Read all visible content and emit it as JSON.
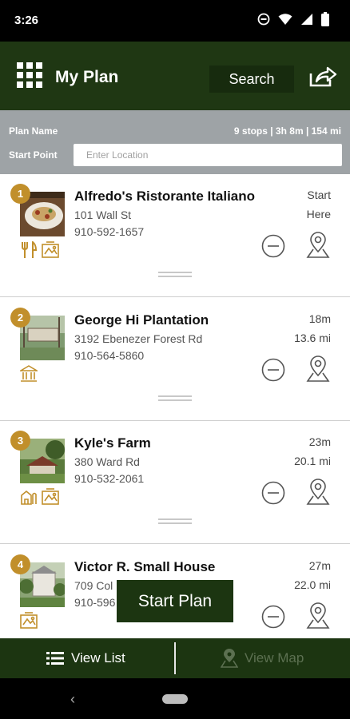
{
  "status_bar": {
    "time": "3:26",
    "icons": [
      "dnd-icon",
      "wifi-icon",
      "signal-icon",
      "battery-icon"
    ]
  },
  "app_bar": {
    "title": "My Plan",
    "search_label": "Search",
    "menu_icon": "grid-menu-icon",
    "share_icon": "share-icon"
  },
  "plan": {
    "name_label": "Plan Name",
    "stats": "9 stops | 3h 8m | 154 mi",
    "start_label": "Start Point",
    "start_placeholder": "Enter Location"
  },
  "stops": [
    {
      "number": "1",
      "name": "Alfredo's Ristorante Italiano",
      "address": "101 Wall St",
      "phone": "910-592-1657",
      "meta_top": "Start",
      "meta_bottom": "Here",
      "categories": [
        "dining-icon",
        "attraction-icon"
      ]
    },
    {
      "number": "2",
      "name": "George Hi Plantation",
      "address": "3192 Ebenezer Forest Rd",
      "phone": "910-564-5860",
      "meta_top": "18m",
      "meta_bottom": "13.6 mi",
      "categories": [
        "historic-building-icon"
      ]
    },
    {
      "number": "3",
      "name": "Kyle's Farm",
      "address": "380 Ward Rd",
      "phone": "910-532-2061",
      "meta_top": "23m",
      "meta_bottom": "20.1 mi",
      "categories": [
        "farm-icon",
        "attraction-icon"
      ]
    },
    {
      "number": "4",
      "name": "Victor R. Small House",
      "address": "709 Col",
      "phone": "910-596",
      "meta_top": "27m",
      "meta_bottom": "22.0 mi",
      "categories": [
        "attraction-icon"
      ]
    }
  ],
  "start_plan_label": "Start Plan",
  "bottom_nav": {
    "list_label": "View List",
    "map_label": "View Map"
  },
  "colors": {
    "brand_green": "#1f3713",
    "accent_gold": "#c18f2b",
    "plan_bar_gray": "#9ea3a6"
  }
}
